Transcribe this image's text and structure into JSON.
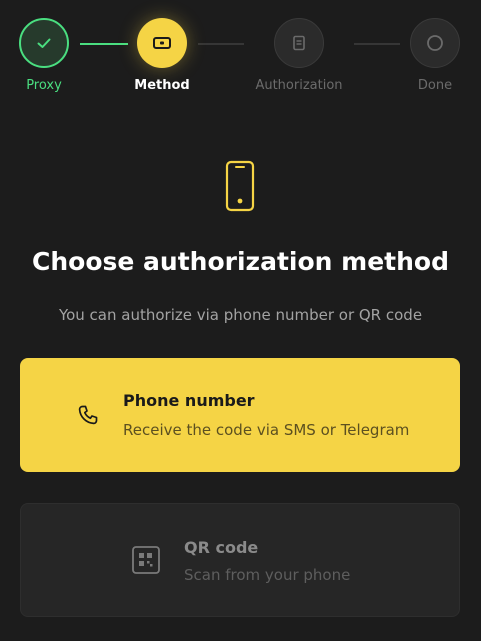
{
  "stepper": {
    "steps": [
      {
        "label": "Proxy",
        "state": "completed",
        "icon": "check-icon"
      },
      {
        "label": "Method",
        "state": "active",
        "icon": "method-icon"
      },
      {
        "label": "Authorization",
        "state": "pending",
        "icon": "document-icon"
      },
      {
        "label": "Done",
        "state": "pending",
        "icon": "circle-icon"
      }
    ]
  },
  "main": {
    "hero_icon": "phone-device-icon",
    "title": "Choose authorization method",
    "subtitle": "You can authorize via phone number or QR code"
  },
  "options": [
    {
      "title": "Phone number",
      "description": "Receive the code via SMS or Telegram",
      "icon": "phone-call-icon",
      "state": "selected"
    },
    {
      "title": "QR code",
      "description": "Scan from your phone",
      "icon": "qr-code-icon",
      "state": "disabled"
    }
  ],
  "colors": {
    "background": "#1c1c1c",
    "accent": "#f5d445",
    "success": "#4ade80",
    "muted_text": "#a3a3a3",
    "pending": "#6b6b6b"
  }
}
